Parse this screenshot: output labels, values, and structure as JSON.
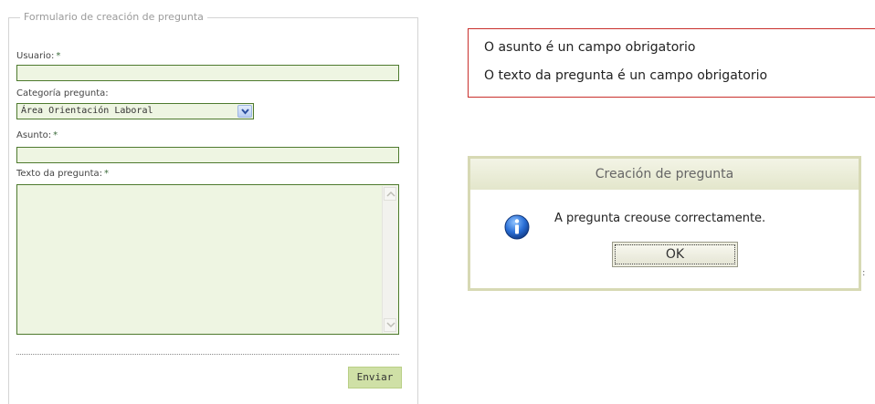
{
  "form": {
    "legend": "Formulario de creación de pregunta",
    "required_mark": "*",
    "user_label": "Usuario:",
    "user_value": "",
    "category_label": "Categoría pregunta:",
    "category_selected": "Área Orientación Laboral",
    "subject_label": "Asunto:",
    "subject_value": "",
    "question_label": "Texto da pregunta:",
    "question_value": "",
    "submit_label": "Enviar"
  },
  "errors": {
    "messages": [
      "O asunto é un campo obrigatorio",
      "O texto da pregunta é un campo obrigatorio"
    ],
    "border_color": "#c9302c"
  },
  "dialog": {
    "title": "Creación de pregunta",
    "icon": "info-icon",
    "message": "A pregunta creouse correctamente.",
    "ok_label": "OK"
  },
  "colors": {
    "field_border": "#4e7a2e",
    "field_background": "#eef5e2",
    "button_background": "#cfe0a6",
    "dialog_border": "#d7d9b4"
  }
}
